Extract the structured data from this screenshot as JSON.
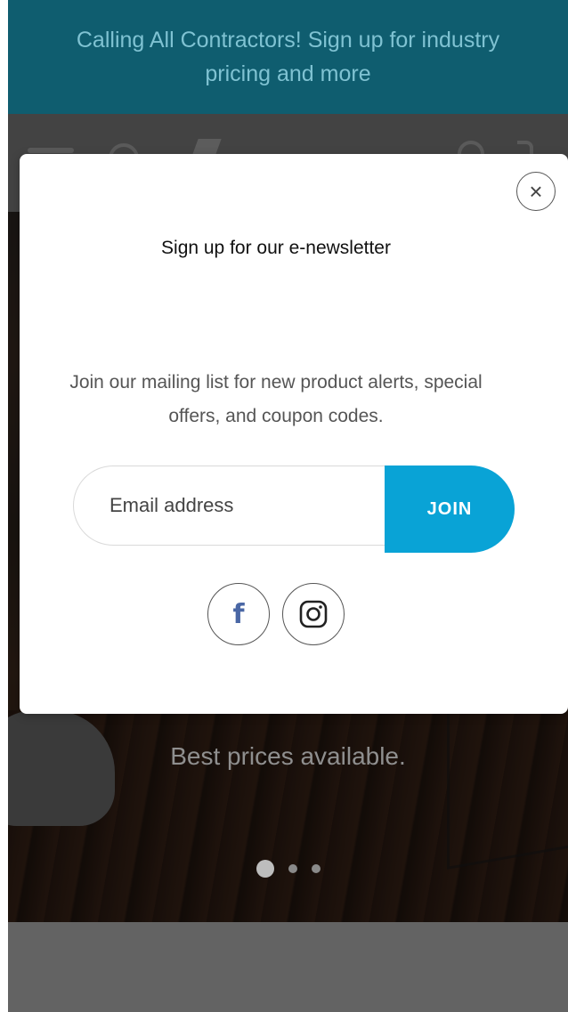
{
  "announcement": {
    "text": "Calling All Contractors! Sign up for industry pricing and more"
  },
  "hero": {
    "tagline": "Best prices available.",
    "slides": [
      1,
      2,
      3
    ],
    "active_slide": 1
  },
  "header_icons": [
    "menu-icon",
    "search-icon",
    "logo-icon",
    "account-icon",
    "cart-icon"
  ],
  "modal": {
    "close_icon": "×",
    "title": "Sign up for our e-newsletter",
    "description": "Join our mailing list for new product alerts, special offers, and coupon codes.",
    "email_placeholder": "Email address",
    "join_label": "JOIN",
    "social": [
      {
        "name": "facebook-icon",
        "glyph": "f"
      },
      {
        "name": "instagram-icon"
      }
    ]
  },
  "colors": {
    "announcement_bg": "#0f5d6f",
    "join_button": "#09a3d6",
    "facebook": "#4a67a5"
  }
}
